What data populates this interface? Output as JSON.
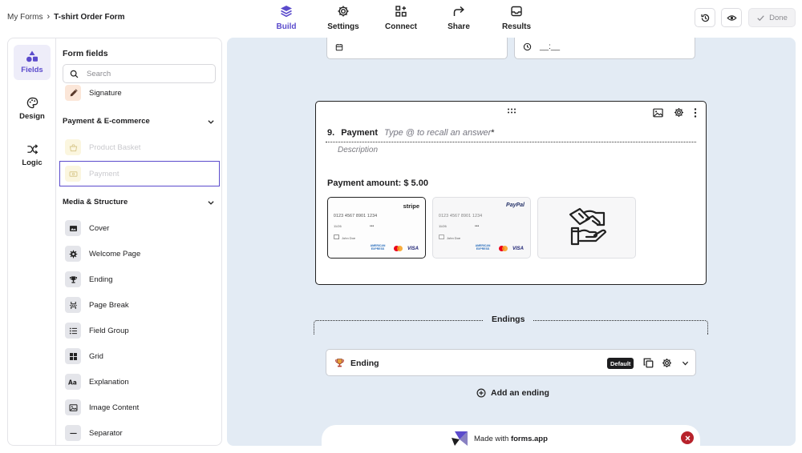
{
  "breadcrumb": {
    "parent": "My Forms",
    "separator": "›",
    "current": "T-shirt Order Form"
  },
  "nav": {
    "tabs": [
      {
        "label": "Build",
        "icon": "layers-icon",
        "active": true
      },
      {
        "label": "Settings",
        "icon": "gear-icon"
      },
      {
        "label": "Connect",
        "icon": "connect-icon"
      },
      {
        "label": "Share",
        "icon": "share-icon"
      },
      {
        "label": "Results",
        "icon": "inbox-icon"
      }
    ]
  },
  "toolbar": {
    "done_label": "Done"
  },
  "rail": {
    "items": [
      {
        "label": "Fields",
        "icon": "shapes-icon",
        "active": true
      },
      {
        "label": "Design",
        "icon": "palette-icon"
      },
      {
        "label": "Logic",
        "icon": "shuffle-icon"
      }
    ]
  },
  "panel": {
    "title": "Form fields",
    "search_placeholder": "Search",
    "partial_item": "Signature",
    "payment_section": {
      "title": "Payment & E-commerce",
      "items": [
        {
          "label": "Product Basket",
          "disabled": true
        },
        {
          "label": "Payment",
          "disabled": true,
          "selected": true
        }
      ]
    },
    "media_section": {
      "title": "Media & Structure",
      "items": [
        {
          "label": "Cover",
          "icon": "cover-icon"
        },
        {
          "label": "Welcome Page",
          "icon": "welcome-gear-icon"
        },
        {
          "label": "Ending",
          "icon": "trophy-icon"
        },
        {
          "label": "Page Break",
          "icon": "page-break-icon"
        },
        {
          "label": "Field Group",
          "icon": "list-icon"
        },
        {
          "label": "Grid",
          "icon": "grid-icon"
        },
        {
          "label": "Explanation",
          "icon": "text-icon"
        },
        {
          "label": "Image Content",
          "icon": "image-icon"
        },
        {
          "label": "Separator",
          "icon": "separator-icon"
        }
      ]
    }
  },
  "canvas": {
    "date_placeholder": "",
    "time_placeholder": "__:__",
    "question": {
      "number": "9.",
      "title": "Payment",
      "placeholder": "Type @ to recall an answer",
      "required_mark": "*",
      "description": "Description",
      "amount_label": "Payment amount: $ 5.00"
    },
    "payment_options": [
      {
        "brand": "stripe",
        "card_number": "0123 4567 8901 1234",
        "expiry": "11/26",
        "cvv": "•••",
        "holder": "John Doe",
        "amex": "AMERICAN EXPRESS",
        "visa": "VISA",
        "selected": true
      },
      {
        "brand": "PayPal",
        "card_number": "0123 4567 8901 1234",
        "expiry": "11/26",
        "cvv": "•••",
        "holder": "John Doe",
        "amex": "AMERICAN EXPRESS",
        "visa": "VISA"
      },
      {
        "brand": "handshake-icon"
      }
    ],
    "endings": {
      "title": "Endings",
      "item_label": "Ending",
      "badge": "Default",
      "add_label": "Add an ending"
    },
    "made_with": {
      "prefix": "Made with",
      "brand": "forms.app"
    }
  },
  "colors": {
    "accent": "#5b4bcc",
    "canvas_bg": "#e3ebf4",
    "badge_bg": "#1d1d1f",
    "close_red": "#b7222b"
  }
}
